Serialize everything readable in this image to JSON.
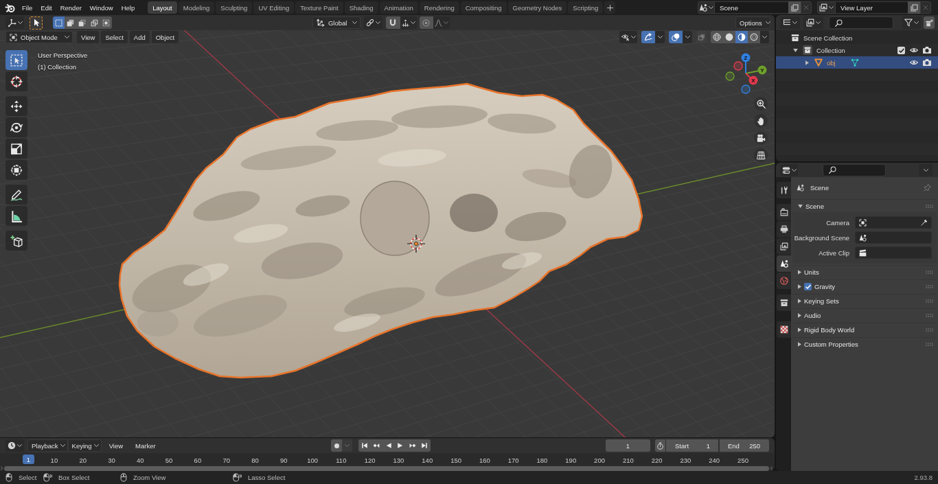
{
  "top_bar": {
    "menus": [
      "File",
      "Edit",
      "Render",
      "Window",
      "Help"
    ],
    "workspaces": [
      {
        "label": "Layout",
        "selected": true
      },
      {
        "label": "Modeling",
        "selected": false
      },
      {
        "label": "Sculpting",
        "selected": false
      },
      {
        "label": "UV Editing",
        "selected": false
      },
      {
        "label": "Texture Paint",
        "selected": false
      },
      {
        "label": "Shading",
        "selected": false
      },
      {
        "label": "Animation",
        "selected": false
      },
      {
        "label": "Rendering",
        "selected": false
      },
      {
        "label": "Compositing",
        "selected": false
      },
      {
        "label": "Geometry Nodes",
        "selected": false
      },
      {
        "label": "Scripting",
        "selected": false
      }
    ],
    "scene": "Scene",
    "view_layer": "View Layer"
  },
  "viewport": {
    "tool_header": {
      "select_modes": [
        {
          "selected": true
        },
        {
          "selected": false
        },
        {
          "selected": false
        },
        {
          "selected": false
        },
        {
          "selected": false
        }
      ],
      "orientation": "Global",
      "options": "Options"
    },
    "header": {
      "mode": "Object Mode",
      "menus": [
        "View",
        "Select",
        "Add",
        "Object"
      ],
      "gizmos_on": true,
      "overlays_on": true,
      "shading_modes": [
        {
          "selected": false
        },
        {
          "selected": false
        },
        {
          "selected": true
        },
        {
          "selected": false
        }
      ]
    },
    "tool_groups": [
      [
        {
          "selected": true
        },
        {
          "selected": false
        }
      ],
      [
        {
          "selected": false
        },
        {
          "selected": false
        },
        {
          "selected": false
        },
        {
          "selected": false
        }
      ],
      [
        {
          "selected": false
        },
        {
          "selected": false
        }
      ],
      [
        {
          "selected": false
        }
      ]
    ],
    "info": [
      "User Perspective",
      "(1) Collection"
    ],
    "axes": [
      {
        "label": "Z",
        "color": "#2f7fe0"
      },
      {
        "label": "Y",
        "color": "#6ea02a"
      },
      {
        "label": "X",
        "color": "#e23a4e"
      }
    ]
  },
  "outliner": {
    "tree": [
      {
        "label": "Scene Collection",
        "kind": "scene",
        "selected": false,
        "children": [
          {
            "label": "Collection",
            "kind": "collection",
            "selected": false,
            "expanded": true,
            "checked": true,
            "children": [
              {
                "label": "obj",
                "kind": "object",
                "selected": true,
                "expanded": false
              }
            ]
          }
        ]
      }
    ]
  },
  "properties": {
    "tabs": [
      {
        "selected": false
      },
      {
        "selected": false
      },
      {
        "selected": false
      },
      {
        "selected": false
      },
      {
        "selected": true
      },
      {
        "selected": false
      },
      {
        "selected": false
      },
      {
        "selected": false
      }
    ],
    "context": "Scene",
    "panel": {
      "title": "Scene",
      "expanded": true,
      "fields": [
        {
          "label": "Camera",
          "kind": "object"
        },
        {
          "label": "Background Scene",
          "kind": "scene"
        },
        {
          "label": "Active Clip",
          "kind": "clip"
        }
      ]
    },
    "subpanels": [
      {
        "title": "Units",
        "expanded": false
      },
      {
        "title": "Gravity",
        "expanded": false,
        "checked": true
      },
      {
        "title": "Keying Sets",
        "expanded": false
      },
      {
        "title": "Audio",
        "expanded": false
      },
      {
        "title": "Rigid Body World",
        "expanded": false
      },
      {
        "title": "Custom Properties",
        "expanded": false
      }
    ]
  },
  "timeline": {
    "menus": [
      {
        "label": "Playback",
        "kind": "dropdown"
      },
      {
        "label": "Keying",
        "kind": "dropdown"
      },
      {
        "label": "View",
        "kind": "menu"
      },
      {
        "label": "Marker",
        "kind": "menu"
      }
    ],
    "current_frame": "1",
    "start": {
      "label": "Start",
      "value": "1"
    },
    "end": {
      "label": "End",
      "value": "250"
    },
    "playhead": "1",
    "ruler": [
      "10",
      "20",
      "30",
      "40",
      "50",
      "60",
      "70",
      "80",
      "90",
      "100",
      "110",
      "120",
      "130",
      "140",
      "150",
      "160",
      "170",
      "180",
      "190",
      "200",
      "210",
      "220",
      "230",
      "240",
      "250"
    ]
  },
  "status_bar": {
    "hints": [
      "Select",
      "Box Select",
      "Zoom View",
      "Lasso Select"
    ],
    "version": "2.93.8"
  }
}
